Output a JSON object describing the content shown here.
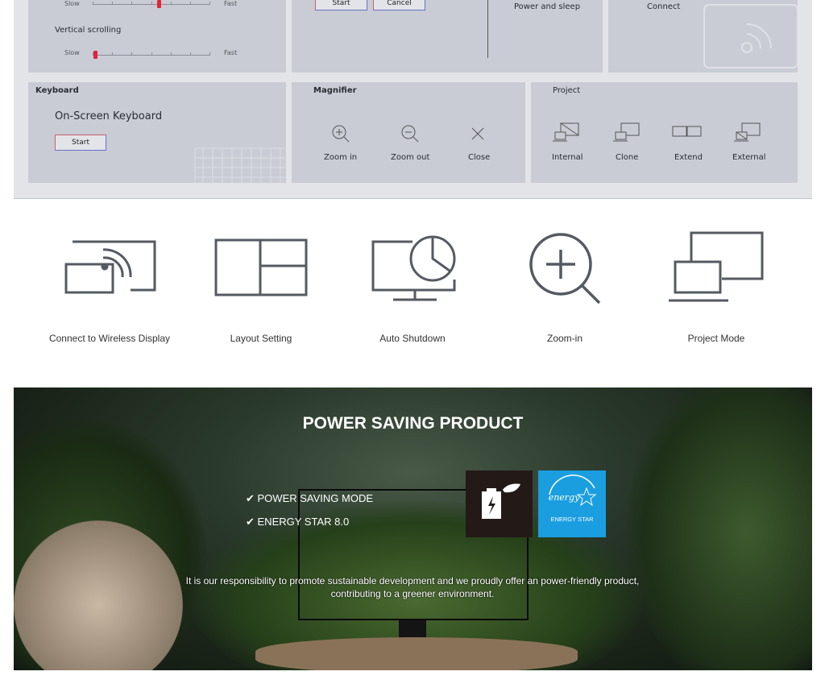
{
  "screenshot": {
    "mouse": {
      "slow": "Slow",
      "fast": "Fast",
      "vertical_scrolling": "Vertical scrolling",
      "slow2": "Slow",
      "fast2": "Fast",
      "h_value_fraction": 0.57,
      "v_value_fraction": 0.0
    },
    "dialog": {
      "start": "Start",
      "cancel": "Cancel"
    },
    "power": {
      "label": "Power and sleep"
    },
    "connect": {
      "label": "Connect"
    },
    "keyboard": {
      "title": "Keyboard",
      "subtitle": "On-Screen Keyboard",
      "start": "Start"
    },
    "magnifier": {
      "title": "Magnifier",
      "items": [
        "Zoom in",
        "Zoom out",
        "Close"
      ]
    },
    "project": {
      "title": "Project",
      "items": [
        "Internal",
        "Clone",
        "Extend",
        "External"
      ]
    }
  },
  "features": [
    "Connect to Wireless Display",
    "Layout Setting",
    "Auto Shutdown",
    "Zoom-in",
    "Project Mode"
  ],
  "banner": {
    "title": "POWER SAVING PRODUCT",
    "checks": [
      "POWER SAVING MODE",
      "ENERGY STAR 8.0"
    ],
    "energy_star_logo": "energy",
    "energy_star_label": "ENERGY STAR",
    "text": "It is our responsibility to promote sustainable development and we proudly offer an power-friendly product, contributing to a greener environment.",
    "colors": {
      "energy_blue": "#1a9ee0",
      "badge_dark": "#231a18"
    }
  }
}
